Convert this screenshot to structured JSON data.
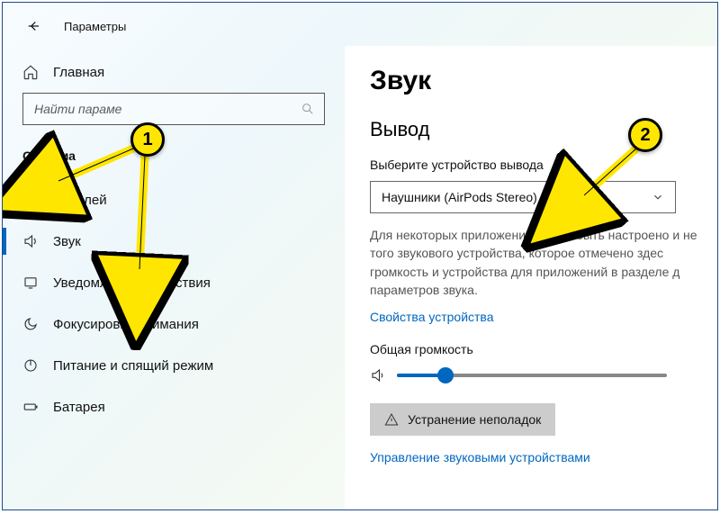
{
  "header": {
    "back": "←",
    "title": "Параметры"
  },
  "sidebar": {
    "home": "Главная",
    "search_placeholder": "Найти параме",
    "group": "Система",
    "items": [
      {
        "label": "Дисплей"
      },
      {
        "label": "Звук"
      },
      {
        "label": "Уведомления и действия"
      },
      {
        "label": "Фокусировка внимания"
      },
      {
        "label": "Питание и спящий режим"
      },
      {
        "label": "Батарея"
      }
    ]
  },
  "content": {
    "title": "Звук",
    "output": {
      "title": "Вывод",
      "field_label": "Выберите устройство вывода",
      "selected": "Наушники (AirPods Stereo)",
      "description": "Для некоторых приложений может быть настроено и не того звукового устройства, которое отмечено здес громкость и устройства для приложений в разделе д параметров звука.",
      "props_link": "Свойства устройства",
      "volume_label": "Общая громкость",
      "volume_percent": 18,
      "troubleshoot": "Устранение неполадок",
      "manage_link": "Управление звуковыми устройствами"
    }
  },
  "annotations": {
    "marker1": "1",
    "marker2": "2"
  }
}
